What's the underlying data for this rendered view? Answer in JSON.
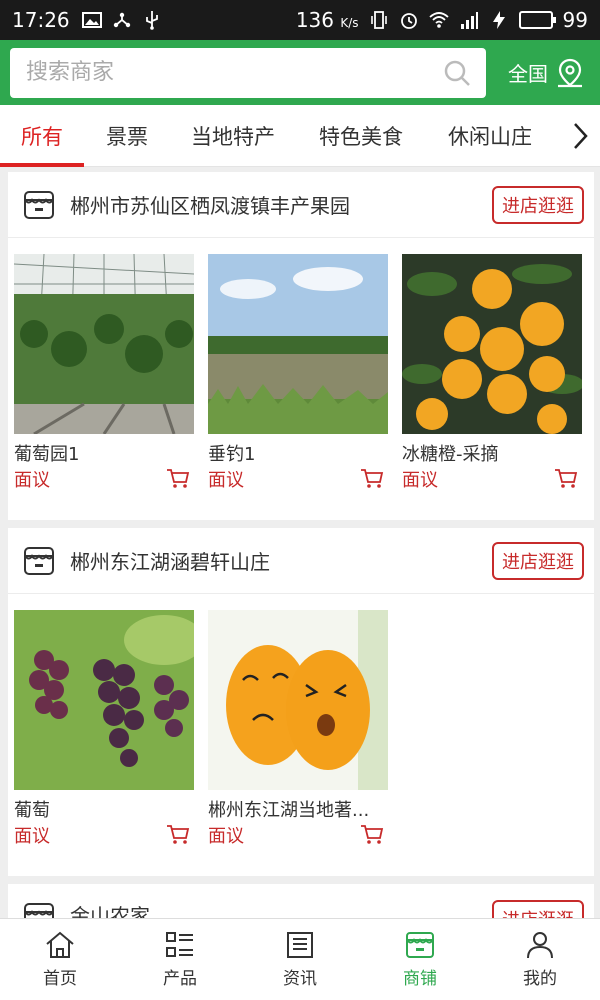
{
  "status_bar": {
    "time": "17:26",
    "speed": "136",
    "speed_unit": "K/s",
    "battery": "99",
    "battery_level": 0.99
  },
  "search": {
    "placeholder": "搜索商家",
    "region_label": "全国"
  },
  "tabs": [
    {
      "label": "所有",
      "active": true
    },
    {
      "label": "景票",
      "active": false
    },
    {
      "label": "当地特产",
      "active": false
    },
    {
      "label": "特色美食",
      "active": false
    },
    {
      "label": "休闲山庄",
      "active": false
    }
  ],
  "shops": [
    {
      "name": "郴州市苏仙区栖凤渡镇丰产果园",
      "visit_label": "进店逛逛",
      "products": [
        {
          "name": "葡萄园1",
          "price": "面议"
        },
        {
          "name": "垂钓1",
          "price": "面议"
        },
        {
          "name": "冰糖橙-采摘",
          "price": "面议"
        }
      ]
    },
    {
      "name": "郴州东江湖涵碧轩山庄",
      "visit_label": "进店逛逛",
      "products": [
        {
          "name": "葡萄",
          "price": "面议"
        },
        {
          "name": "郴州东江湖当地著...",
          "price": "面议"
        }
      ]
    },
    {
      "name": "金山农家",
      "visit_label": "进店逛逛",
      "products": []
    }
  ],
  "bottom_nav": [
    {
      "label": "首页",
      "icon": "home-icon",
      "active": false
    },
    {
      "label": "产品",
      "icon": "grid-list-icon",
      "active": false
    },
    {
      "label": "资讯",
      "icon": "news-icon",
      "active": false
    },
    {
      "label": "商铺",
      "icon": "store-icon",
      "active": true
    },
    {
      "label": "我的",
      "icon": "user-icon",
      "active": false
    }
  ],
  "colors": {
    "brand_green": "#2fa84f",
    "accent_red": "#c72b2b",
    "status_bar": "#1a1a1a"
  }
}
